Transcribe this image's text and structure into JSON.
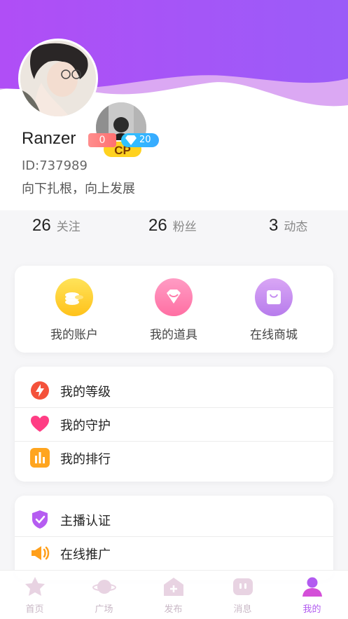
{
  "profile": {
    "username": "Ranzer",
    "cp_badge": "CP",
    "level_badge": "0",
    "diamond_badge": "20",
    "user_id": "ID:737989",
    "signature": "向下扎根，向上发展"
  },
  "stats": [
    {
      "num": "26",
      "label": "关注"
    },
    {
      "num": "26",
      "label": "粉丝"
    },
    {
      "num": "3",
      "label": "动态"
    }
  ],
  "quick_actions": [
    {
      "label": "我的账户",
      "icon": "coins-icon"
    },
    {
      "label": "我的道具",
      "icon": "gem-icon"
    },
    {
      "label": "在线商城",
      "icon": "shopping-bag-icon"
    }
  ],
  "menu_group1": [
    {
      "label": "我的等级",
      "icon": "lightning-icon"
    },
    {
      "label": "我的守护",
      "icon": "heart-icon"
    },
    {
      "label": "我的排行",
      "icon": "bar-chart-icon"
    }
  ],
  "menu_group2": [
    {
      "label": "主播认证",
      "icon": "shield-check-icon"
    },
    {
      "label": "在线推广",
      "icon": "megaphone-icon"
    }
  ],
  "tabbar": [
    {
      "label": "首页",
      "icon": "star-icon"
    },
    {
      "label": "广场",
      "icon": "planet-icon"
    },
    {
      "label": "发布",
      "icon": "publish-icon"
    },
    {
      "label": "消息",
      "icon": "message-icon"
    },
    {
      "label": "我的",
      "icon": "user-icon",
      "active": true
    }
  ],
  "colors": {
    "header_purple": "#a259f7",
    "header_light": "#d9a6f5",
    "active_tab": "#b25bf0"
  }
}
